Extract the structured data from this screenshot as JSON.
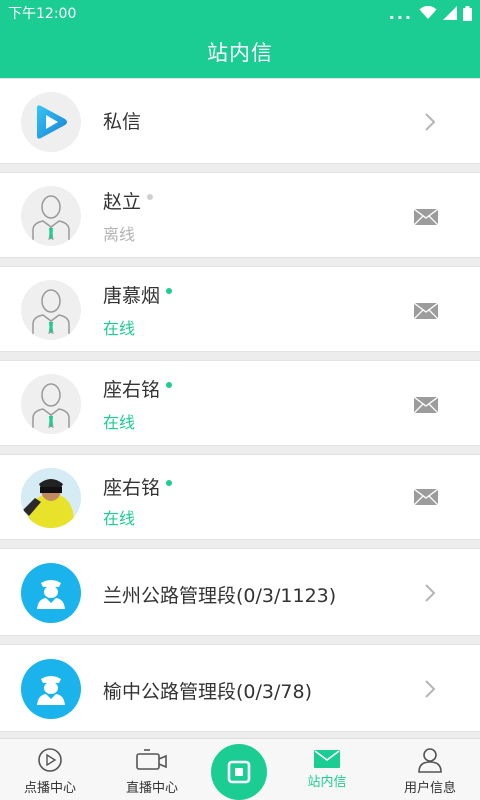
{
  "status_bar": {
    "time": "下午12:00",
    "dots": "..."
  },
  "header": {
    "title": "站内信"
  },
  "private_message": {
    "label": "私信"
  },
  "contacts": [
    {
      "name": "赵立",
      "status": "离线",
      "online": false
    },
    {
      "name": "唐慕烟",
      "status": "在线",
      "online": true
    },
    {
      "name": "座右铭",
      "status": "在线",
      "online": true
    },
    {
      "name": "座右铭",
      "status": "在线",
      "online": true
    }
  ],
  "groups": [
    {
      "label": "兰州公路管理段(0/3/1123)"
    },
    {
      "label": "榆中公路管理段(0/3/78)"
    }
  ],
  "bottom_nav": [
    {
      "label": "点播中心"
    },
    {
      "label": "直播中心"
    },
    {
      "label": "站内信"
    },
    {
      "label": "用户信息"
    }
  ],
  "colors": {
    "accent": "#1ccd93",
    "group_avatar": "#1ab3ec"
  }
}
